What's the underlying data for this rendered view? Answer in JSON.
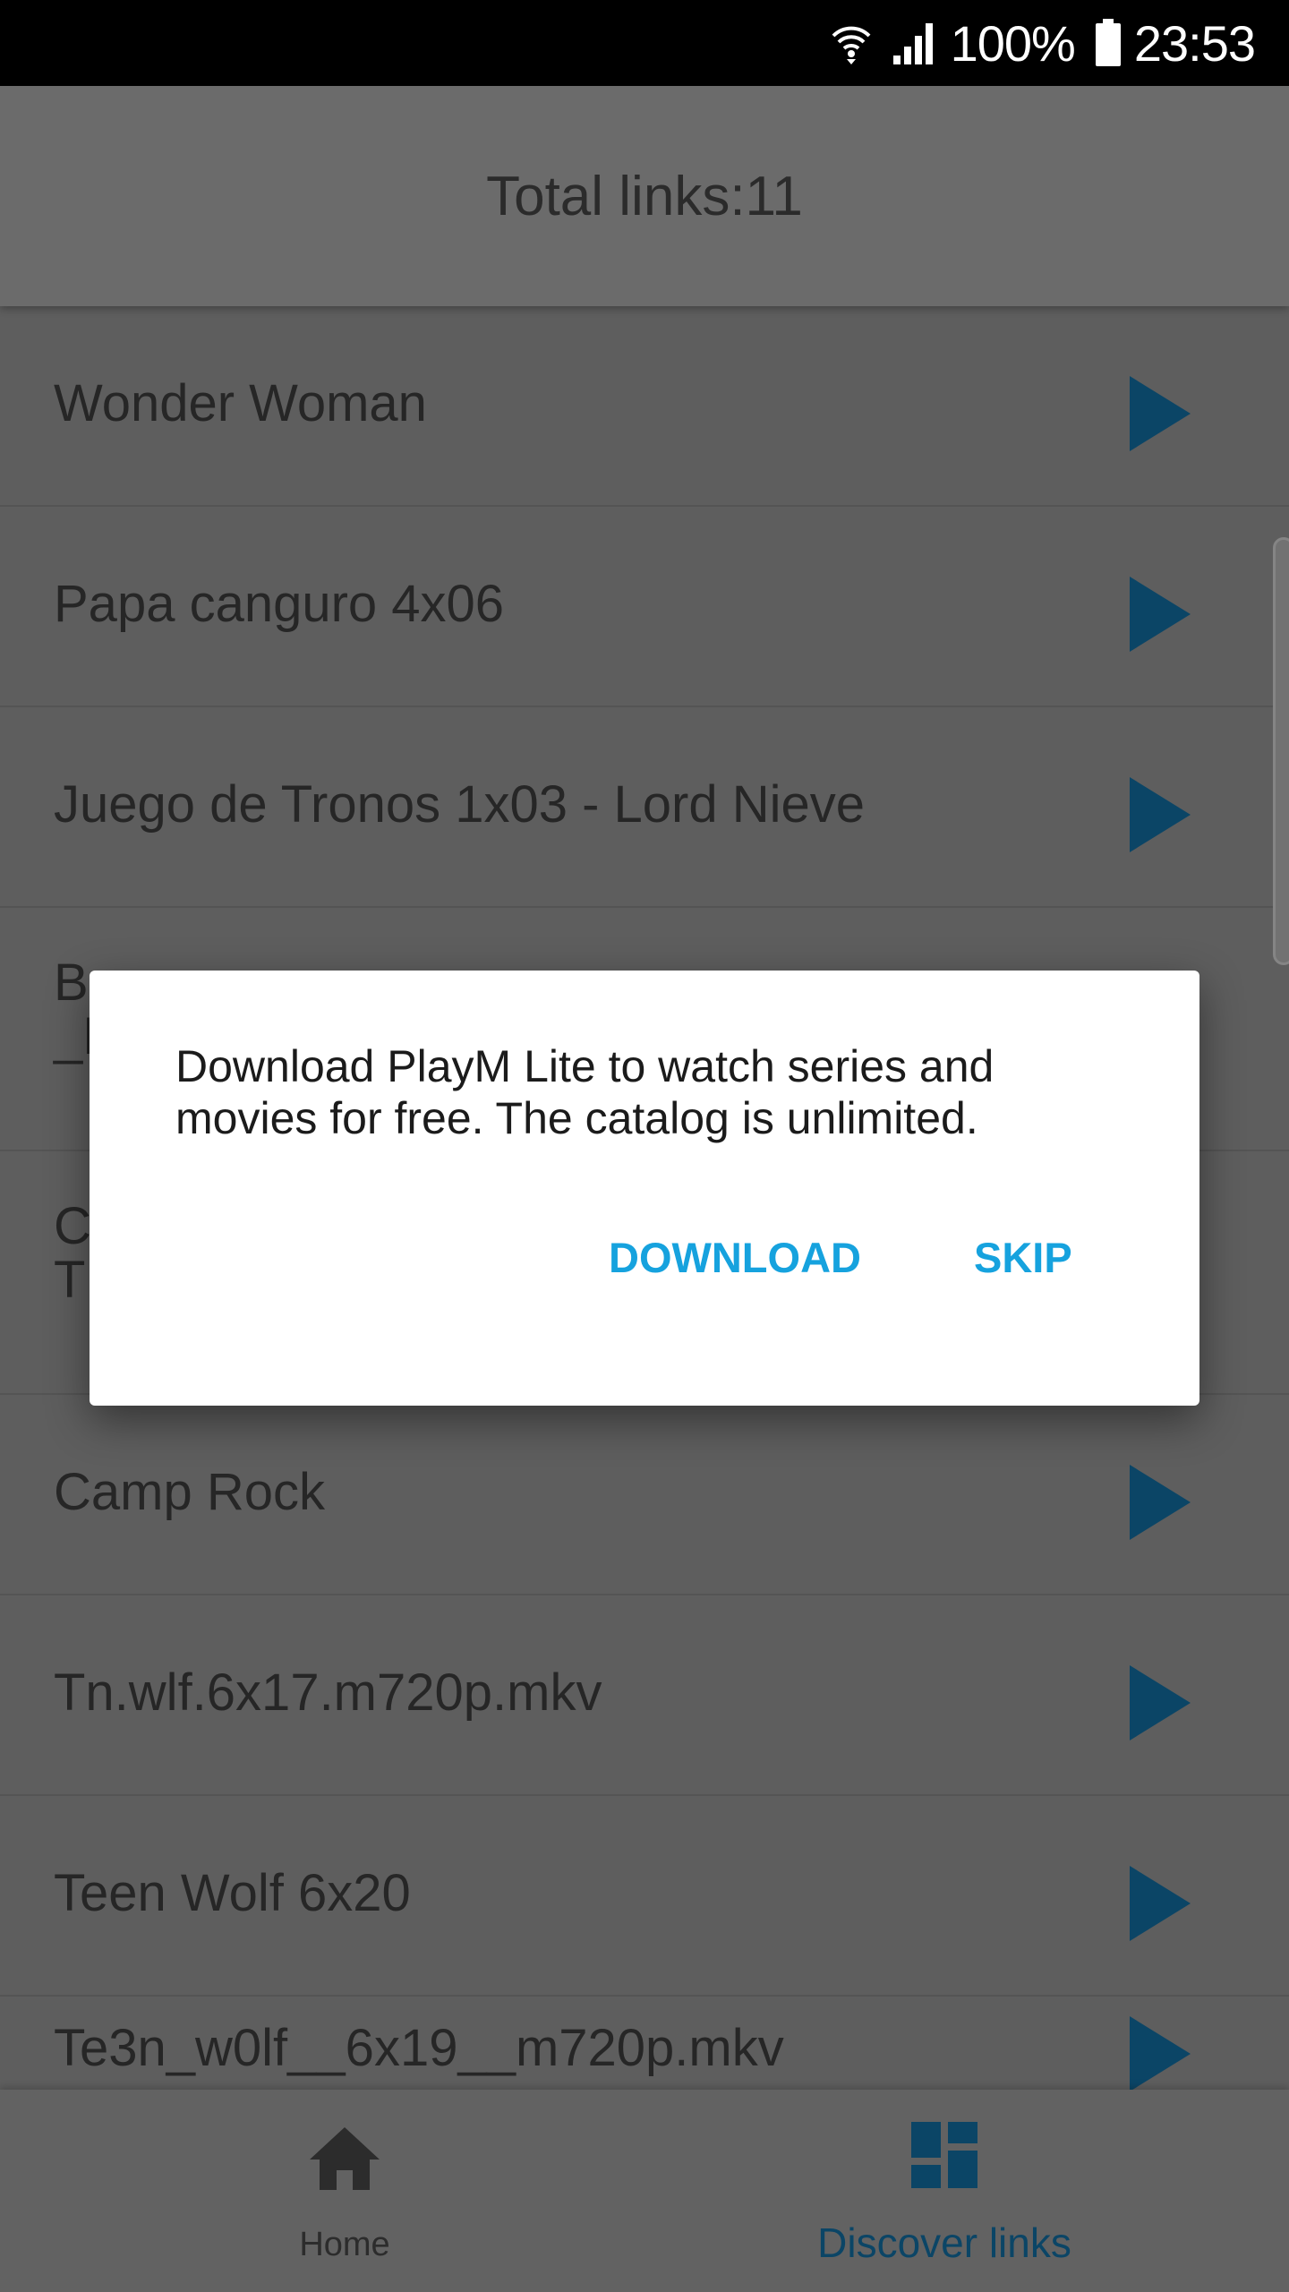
{
  "status_bar": {
    "battery": "100%",
    "time": "23:53",
    "icons": [
      "wifi-icon",
      "signal-icon",
      "battery-icon"
    ]
  },
  "header": {
    "title": "Total links:11"
  },
  "list": {
    "items": [
      {
        "title": "Wonder Woman"
      },
      {
        "title": "Papa canguro 4x06"
      },
      {
        "title": "Juego de Tronos 1x03 - Lord Nieve"
      },
      {
        "title": "B\n_E"
      },
      {
        "title": "C\nT"
      },
      {
        "title": "Camp Rock"
      },
      {
        "title": "Tn.wlf.6x17.m720p.mkv"
      },
      {
        "title": "Teen Wolf 6x20"
      },
      {
        "title": "Te3n_w0lf__6x19__m720p.mkv"
      }
    ]
  },
  "dialog": {
    "message": "Download PlayM Lite to watch series and movies for free. The catalog is unlimited.",
    "download_label": "DOWNLOAD",
    "skip_label": "SKIP"
  },
  "bottom_nav": {
    "home_label": "Home",
    "discover_label": "Discover links"
  },
  "colors": {
    "accent": "#16a2de",
    "play_icon": "#0b4566",
    "scrim_background": "#5e5e5e"
  }
}
